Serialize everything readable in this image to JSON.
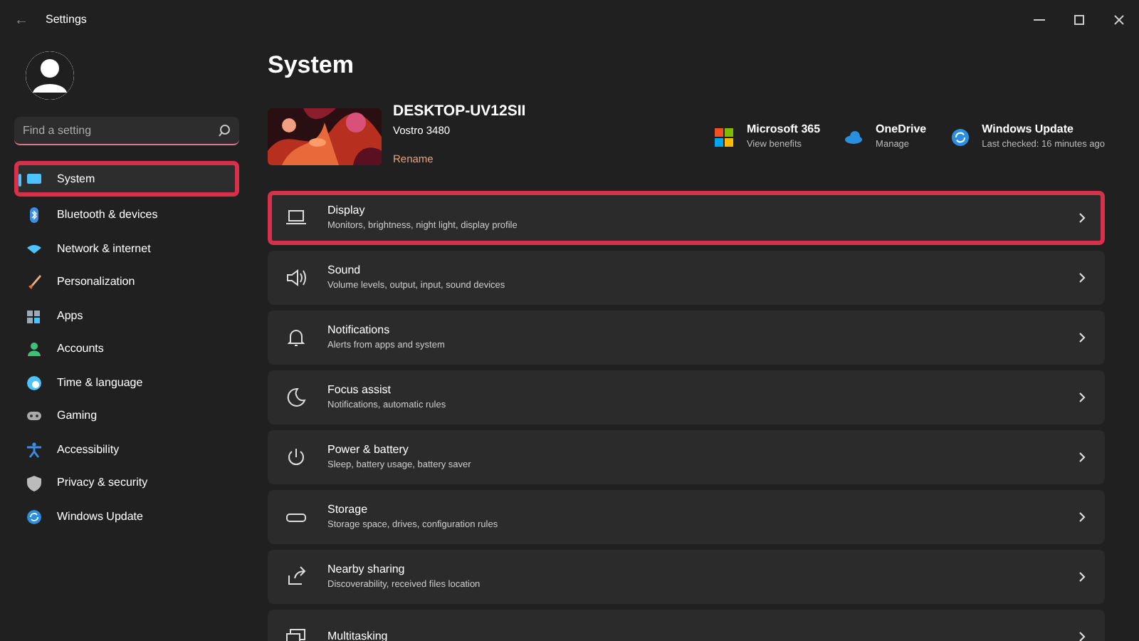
{
  "window": {
    "title": "Settings",
    "back": "←"
  },
  "account": {
    "search": {
      "placeholder": "Find a setting"
    }
  },
  "sidebar": {
    "items": [
      {
        "label": "System",
        "selected": true,
        "highlighted": true
      },
      {
        "label": "Bluetooth & devices",
        "selected": false,
        "highlighted": false
      },
      {
        "label": "Network & internet",
        "selected": false,
        "highlighted": false
      },
      {
        "label": "Personalization",
        "selected": false,
        "highlighted": false
      },
      {
        "label": "Apps",
        "selected": false,
        "highlighted": false
      },
      {
        "label": "Accounts",
        "selected": false,
        "highlighted": false
      },
      {
        "label": "Time & language",
        "selected": false,
        "highlighted": false
      },
      {
        "label": "Gaming",
        "selected": false,
        "highlighted": false
      },
      {
        "label": "Accessibility",
        "selected": false,
        "highlighted": false
      },
      {
        "label": "Privacy & security",
        "selected": false,
        "highlighted": false
      },
      {
        "label": "Windows Update",
        "selected": false,
        "highlighted": false
      }
    ]
  },
  "page": {
    "title": "System",
    "device": {
      "name": "DESKTOP-UV12SII",
      "model": "Vostro 3480",
      "rename": "Rename"
    },
    "services": [
      {
        "title": "Microsoft 365",
        "subtitle": "View benefits"
      },
      {
        "title": "OneDrive",
        "subtitle": "Manage"
      },
      {
        "title": "Windows Update",
        "subtitle": "Last checked: 16 minutes ago"
      }
    ],
    "settings": [
      {
        "title": "Display",
        "subtitle": "Monitors, brightness, night light, display profile",
        "highlighted": true
      },
      {
        "title": "Sound",
        "subtitle": "Volume levels, output, input, sound devices",
        "highlighted": false
      },
      {
        "title": "Notifications",
        "subtitle": "Alerts from apps and system",
        "highlighted": false
      },
      {
        "title": "Focus assist",
        "subtitle": "Notifications, automatic rules",
        "highlighted": false
      },
      {
        "title": "Power & battery",
        "subtitle": "Sleep, battery usage, battery saver",
        "highlighted": false
      },
      {
        "title": "Storage",
        "subtitle": "Storage space, drives, configuration rules",
        "highlighted": false
      },
      {
        "title": "Nearby sharing",
        "subtitle": "Discoverability, received files location",
        "highlighted": false
      },
      {
        "title": "Multitasking",
        "highlighted": false
      }
    ]
  }
}
